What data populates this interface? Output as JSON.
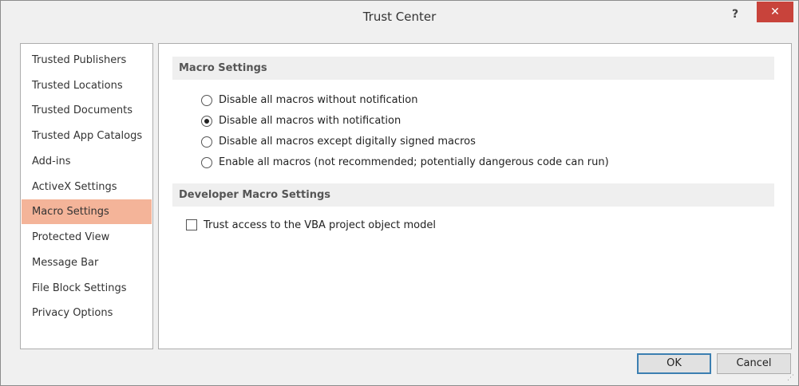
{
  "window": {
    "title": "Trust Center",
    "help_label": "?",
    "close_label": "✕"
  },
  "sidebar": {
    "items": [
      {
        "label": "Trusted Publishers"
      },
      {
        "label": "Trusted Locations"
      },
      {
        "label": "Trusted Documents"
      },
      {
        "label": "Trusted App Catalogs"
      },
      {
        "label": "Add-ins"
      },
      {
        "label": "ActiveX Settings"
      },
      {
        "label": "Macro Settings",
        "selected": true
      },
      {
        "label": "Protected View"
      },
      {
        "label": "Message Bar"
      },
      {
        "label": "File Block Settings"
      },
      {
        "label": "Privacy Options"
      }
    ]
  },
  "macro_settings": {
    "heading": "Macro Settings",
    "options": [
      {
        "label": "Disable all macros without notification",
        "checked": false
      },
      {
        "label": "Disable all macros with notification",
        "checked": true
      },
      {
        "label": "Disable all macros except digitally signed macros",
        "checked": false
      },
      {
        "label": "Enable all macros (not recommended; potentially dangerous code can run)",
        "checked": false
      }
    ]
  },
  "developer_settings": {
    "heading": "Developer Macro Settings",
    "vba_access": {
      "label": "Trust access to the VBA project object model",
      "checked": false
    }
  },
  "buttons": {
    "ok_label": "OK",
    "cancel_label": "Cancel"
  },
  "colors": {
    "selected_nav": "#f4b499",
    "close_button": "#c8433b",
    "section_header": "#efefef"
  }
}
